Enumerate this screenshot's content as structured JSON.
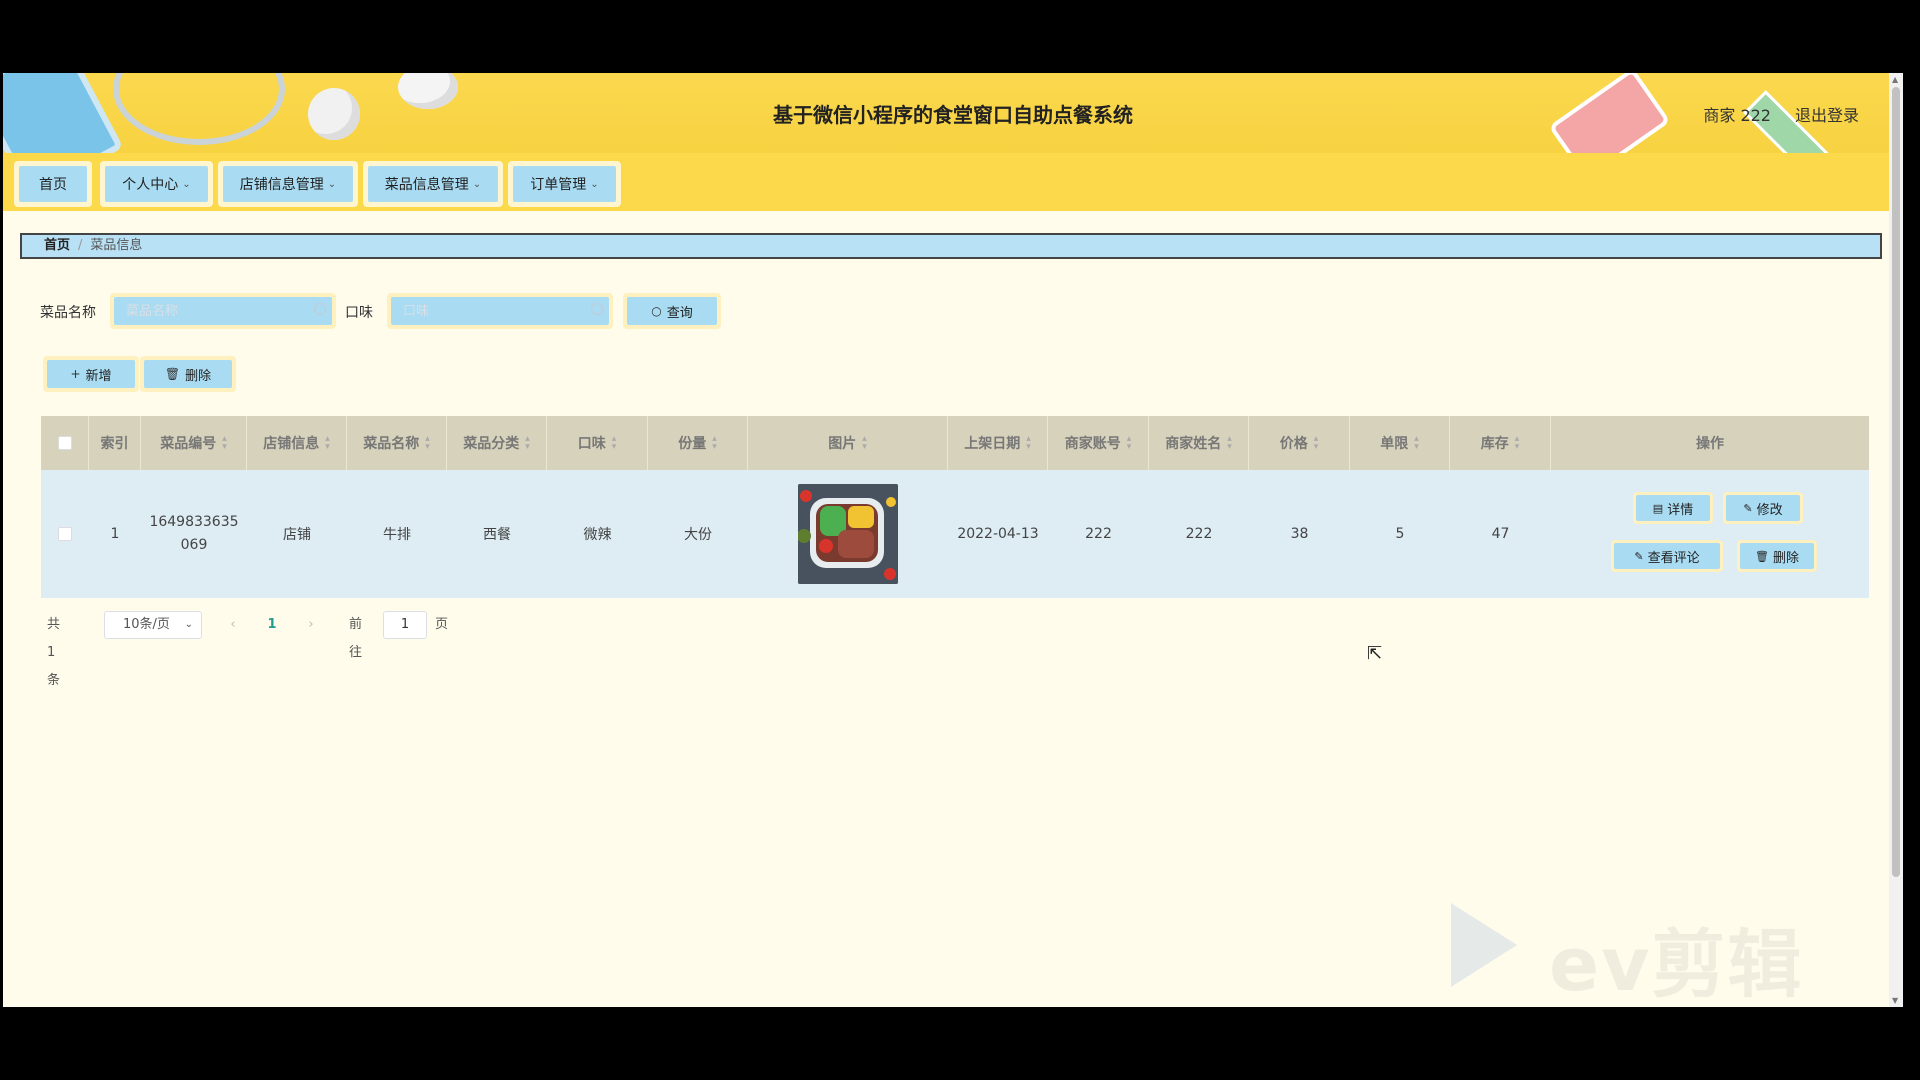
{
  "header": {
    "title": "基于微信小程序的食堂窗口自助点餐系统",
    "user": "商家 222",
    "logout": "退出登录"
  },
  "nav": {
    "items": [
      {
        "label": "首页",
        "dropdown": false
      },
      {
        "label": "个人中心",
        "dropdown": true
      },
      {
        "label": "店铺信息管理",
        "dropdown": true
      },
      {
        "label": "菜品信息管理",
        "dropdown": true
      },
      {
        "label": "订单管理",
        "dropdown": true
      }
    ]
  },
  "breadcrumb": {
    "home": "首页",
    "separator": "/",
    "current": "菜品信息"
  },
  "search": {
    "name_label": "菜品名称",
    "name_placeholder": "菜品名称",
    "taste_label": "口味",
    "taste_placeholder": "口味",
    "query_button": "查询"
  },
  "actions": {
    "add": "新增",
    "delete": "删除"
  },
  "table": {
    "columns": [
      "索引",
      "菜品编号",
      "店铺信息",
      "菜品名称",
      "菜品分类",
      "口味",
      "份量",
      "图片",
      "上架日期",
      "商家账号",
      "商家姓名",
      "价格",
      "单限",
      "库存",
      "操作"
    ],
    "rows": [
      {
        "index": "1",
        "code_line1": "1649833635",
        "code_line2": "069",
        "shop": "店铺",
        "name": "牛排",
        "category": "西餐",
        "taste": "微辣",
        "portion": "大份",
        "date": "2022-04-13",
        "account": "222",
        "merchant": "222",
        "price": "38",
        "limit": "5",
        "stock": "47",
        "ops": {
          "detail": "详情",
          "edit": "修改",
          "comments": "查看评论",
          "delete": "删除"
        }
      }
    ]
  },
  "pagination": {
    "total": "共 1 条",
    "page_size": "10条/页",
    "current_page": "1",
    "goto_label": "前往",
    "goto_value": "1",
    "page_unit": "页"
  },
  "watermark": {
    "text": "ev剪辑"
  },
  "colors": {
    "header": "#f7d241",
    "button": "#a9dcf2",
    "row": "#deecf4",
    "thead": "#d7d2bb",
    "page": "#fffcec"
  }
}
